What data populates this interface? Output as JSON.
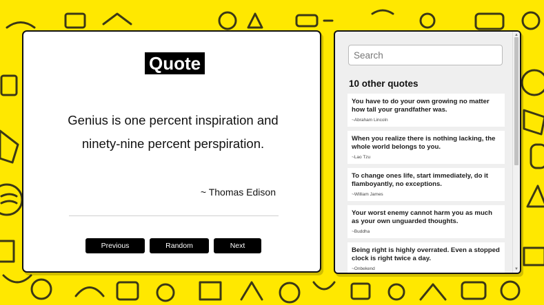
{
  "quote": {
    "title": "Quote",
    "text": "Genius is one percent inspiration and ninety-nine percent perspiration.",
    "author": "~ Thomas Edison"
  },
  "buttons": {
    "previous": "Previous quote",
    "random": "Random quote",
    "next": "Next quote"
  },
  "sidebar": {
    "search_placeholder": "Search",
    "heading": "10 other quotes",
    "items": [
      {
        "text": "You have to do your own growing no matter how tall your grandfather was.",
        "author": "~Abraham Lincoln"
      },
      {
        "text": "When you realize there is nothing lacking, the whole world belongs to you.",
        "author": "~Lao Tzu"
      },
      {
        "text": "To change ones life, start immediately, do it flamboyantly, no exceptions.",
        "author": "~William James"
      },
      {
        "text": "Your worst enemy cannot harm you as much as your own unguarded thoughts.",
        "author": "~Buddha"
      },
      {
        "text": "Being right is highly overrated. Even a stopped clock is right twice a day.",
        "author": "~Onbekend"
      }
    ]
  },
  "colors": {
    "background": "#ffe800",
    "doodle": "#1a1a1a",
    "button": "#000000"
  }
}
